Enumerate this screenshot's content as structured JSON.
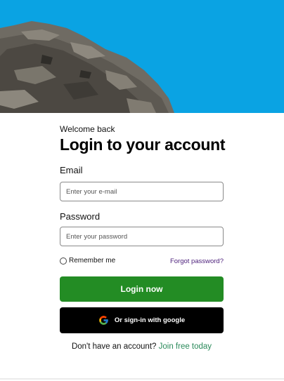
{
  "header": {
    "image_icon": "rock-cliff-sky-photo"
  },
  "form": {
    "welcome": "Welcome back",
    "title": "Login to your account",
    "email": {
      "label": "Email",
      "placeholder": "Enter your e-mail",
      "value": ""
    },
    "password": {
      "label": "Password",
      "placeholder": "Enter your password",
      "value": ""
    },
    "remember_label": "Remember me",
    "forgot_label": "Forgot password?",
    "login_label": "Login now",
    "google_label": "Or sign-in with google",
    "google_icon": "google-g-icon",
    "signup_prompt": "Don't have an account?",
    "signup_link": "Join free today"
  },
  "colors": {
    "primary_button": "#238c24",
    "google_button": "#000000",
    "forgot_link": "#4b1e7a",
    "join_link": "#2a8a5a",
    "sky": "#0aa3e3"
  }
}
